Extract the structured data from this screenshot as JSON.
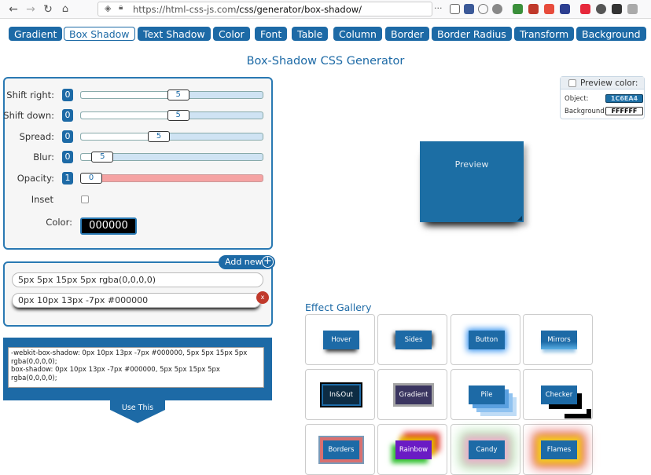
{
  "browser": {
    "url_host": "https://html-css-js.com",
    "url_path": "/css/generator/box-shadow/",
    "menu_dots": "···"
  },
  "nav": [
    "Gradient",
    "Box Shadow",
    "Text Shadow",
    "Color",
    "Font",
    "Table",
    "Column",
    "Border",
    "Border Radius",
    "Transform",
    "Background"
  ],
  "nav_active": "Box Shadow",
  "page_title": "Box-Shadow CSS Generator",
  "controls": {
    "shift_right": {
      "label": "Shift right:",
      "badge": "0",
      "value": "5",
      "fraction": 0.54
    },
    "shift_down": {
      "label": "Shift down:",
      "badge": "0",
      "value": "5",
      "fraction": 0.54
    },
    "spread": {
      "label": "Spread:",
      "badge": "0",
      "value": "5",
      "fraction": 0.42
    },
    "blur": {
      "label": "Blur:",
      "badge": "0",
      "value": "5",
      "fraction": 0.07
    },
    "opacity": {
      "label": "Opacity:",
      "badge": "1",
      "value": "0",
      "fraction": 0.0
    },
    "inset": {
      "label": "Inset",
      "checked": false
    },
    "color": {
      "label": "Color:",
      "value": "000000"
    }
  },
  "add_new_label": "Add new",
  "layers": [
    "5px 5px 15px 5px rgba(0,0,0,0)",
    "0px 10px 13px -7px #000000"
  ],
  "delete_label": "x",
  "code": "-webkit-box-shadow: 0px 10px 13px -7px #000000, 5px 5px 15px 5px rgba(0,0,0,0);\nbox-shadow: 0px 10px 13px -7px #000000, 5px 5px 15px 5px rgba(0,0,0,0);",
  "use_this_label": "Use This",
  "preview_label": "Preview",
  "preview_color": {
    "title": "Preview color:",
    "object_label": "Object:",
    "object_value": "1C6EA4",
    "background_label": "Background:",
    "background_value": "FFFFFF",
    "checked": false
  },
  "gallery": {
    "title": "Effect Gallery",
    "effects": [
      "Hover",
      "Sides",
      "Button",
      "Mirrors",
      "In&Out",
      "Gradient",
      "Pile",
      "Checker",
      "Borders",
      "Rainbow",
      "Candy",
      "Flames"
    ]
  },
  "colors": {
    "accent": "#1d6aa6",
    "object": "#1C6EA4",
    "opacity_track": "#f5a3a3"
  }
}
